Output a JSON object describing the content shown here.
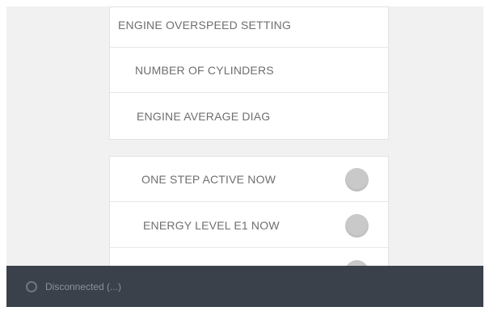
{
  "menu": {
    "items": [
      {
        "label": "ENGINE OVERSPEED SETTING"
      },
      {
        "label": "NUMBER OF CYLINDERS"
      },
      {
        "label": "ENGINE AVERAGE DIAG"
      }
    ]
  },
  "toggles": {
    "items": [
      {
        "label": "ONE STEP ACTIVE NOW",
        "state": "off"
      },
      {
        "label": "ENERGY LEVEL E1 NOW",
        "state": "off"
      },
      {
        "label": "",
        "state": "off"
      }
    ]
  },
  "status": {
    "text": "Disconnected (...)",
    "icon": "status-circle-icon"
  },
  "colors": {
    "status_bar": "#3a414b",
    "background": "#f1f1f1",
    "toggle_off": "#c9c9c9",
    "text": "#6f6f6f"
  }
}
